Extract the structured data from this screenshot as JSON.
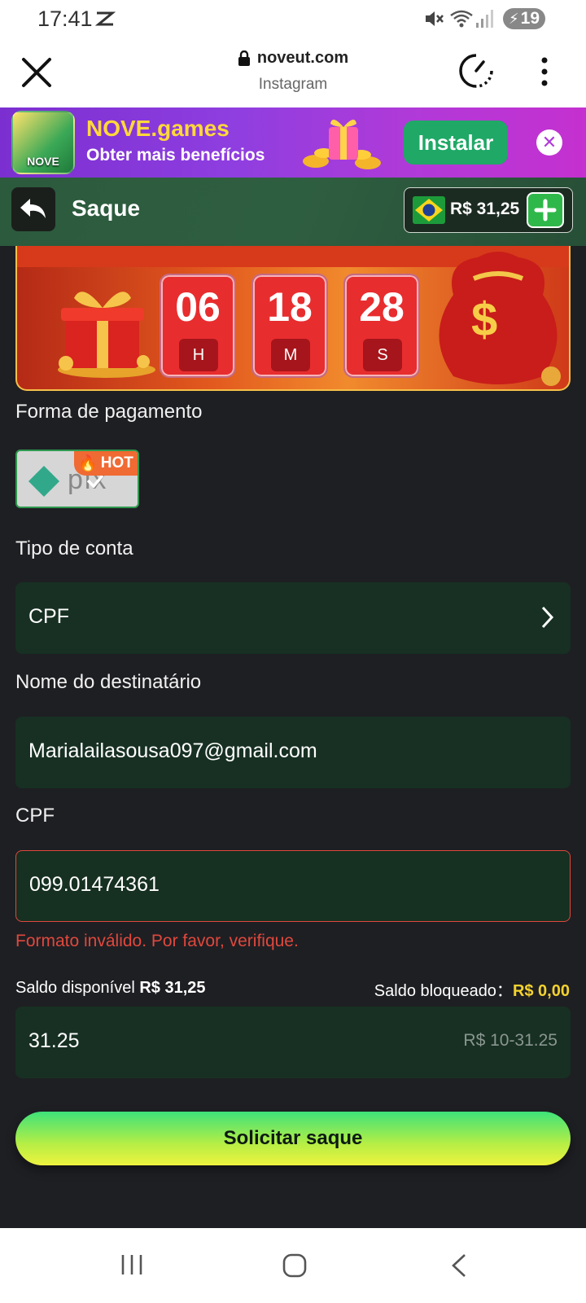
{
  "status_bar": {
    "time": "17:41",
    "battery": "19"
  },
  "browser": {
    "url": "noveut.com",
    "subtitle": "Instagram"
  },
  "promo": {
    "title": "NOVE.games",
    "subtitle": "Obter mais benefícios",
    "install_label": "Instalar",
    "close_symbol": "✕"
  },
  "header": {
    "title": "Saque",
    "balance": "R$ 31,25"
  },
  "countdown": {
    "hours": "06",
    "hours_unit": "H",
    "minutes": "18",
    "minutes_unit": "M",
    "seconds": "28",
    "seconds_unit": "S"
  },
  "form": {
    "payment_label": "Forma de pagamento",
    "payment_badge": "HOT",
    "account_type_label": "Tipo de conta",
    "account_type_value": "CPF",
    "recipient_label": "Nome do destinatário",
    "recipient_value": "Marialailasousa097@gmail.com",
    "cpf_label": "CPF",
    "cpf_value": "099.01474361",
    "cpf_error": "Formato inválido. Por favor, verifique.",
    "available_label": "Saldo disponível",
    "available_amount": "R$ 31,25",
    "blocked_label": "Saldo bloqueado：",
    "blocked_amount": "R$ 0,00",
    "amount_value": "31.25",
    "amount_range": "R$ 10-31.25",
    "submit_label": "Solicitar saque"
  },
  "colors": {
    "accent_green": "#2fb84a",
    "error": "#e0483d",
    "field_bg": "#173023",
    "page_bg": "#1e1f23"
  }
}
